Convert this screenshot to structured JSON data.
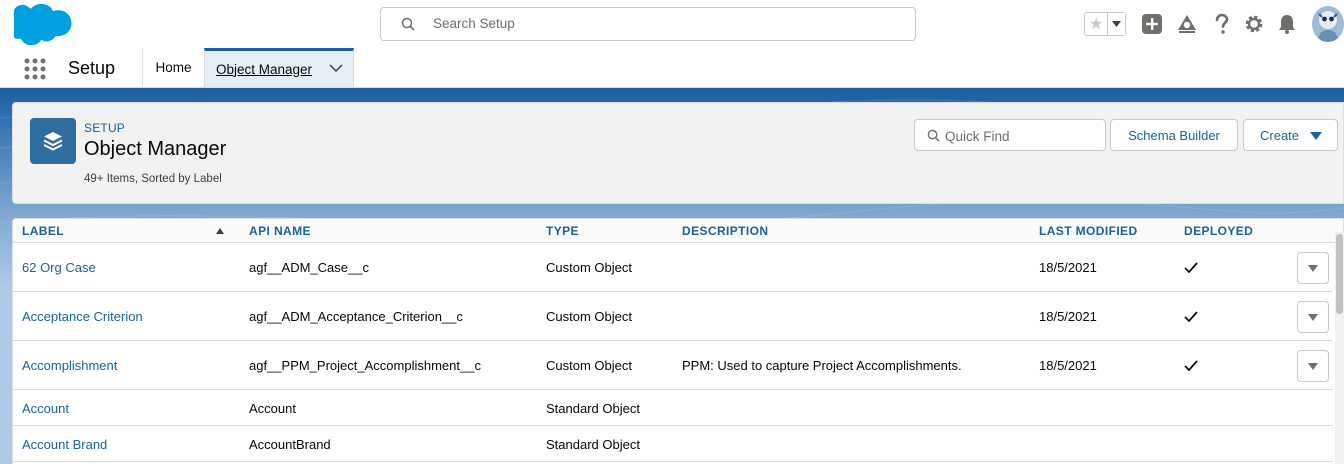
{
  "topbar": {
    "logo": "salesforce-cloud-logo",
    "search_placeholder": "Search Setup",
    "icons": [
      "star-icon",
      "chevron-down-icon",
      "add-icon",
      "trailhead-icon",
      "help-icon",
      "gear-icon",
      "bell-icon",
      "avatar"
    ]
  },
  "nav": {
    "app_name": "Setup",
    "tabs": [
      {
        "label": "Home"
      },
      {
        "label": "Object Manager"
      }
    ]
  },
  "header": {
    "breadcrumb": "SETUP",
    "title": "Object Manager",
    "subtitle": "49+ Items, Sorted by Label",
    "quick_find_placeholder": "Quick Find",
    "schema_builder_label": "Schema Builder",
    "create_label": "Create"
  },
  "table": {
    "columns": [
      "LABEL",
      "API NAME",
      "TYPE",
      "DESCRIPTION",
      "LAST MODIFIED",
      "DEPLOYED"
    ],
    "rows": [
      {
        "label": "62 Org Case",
        "api_name": "agf__ADM_Case__c",
        "type": "Custom Object",
        "description": "",
        "last_modified": "18/5/2021",
        "deployed": true
      },
      {
        "label": "Acceptance Criterion",
        "api_name": "agf__ADM_Acceptance_Criterion__c",
        "type": "Custom Object",
        "description": "",
        "last_modified": "18/5/2021",
        "deployed": true
      },
      {
        "label": "Accomplishment",
        "api_name": "agf__PPM_Project_Accomplishment__c",
        "type": "Custom Object",
        "description": "PPM: Used to capture Project Accomplishments.",
        "last_modified": "18/5/2021",
        "deployed": true
      },
      {
        "label": "Account",
        "api_name": "Account",
        "type": "Standard Object",
        "description": "",
        "last_modified": "",
        "deployed": false
      },
      {
        "label": "Account Brand",
        "api_name": "AccountBrand",
        "type": "Standard Object",
        "description": "",
        "last_modified": "",
        "deployed": false
      }
    ]
  },
  "colors": {
    "brand_blue": "#1b5f9e",
    "salesforce_cloud": "#00a1e0",
    "object_icon_bg": "#2e6d9e"
  }
}
